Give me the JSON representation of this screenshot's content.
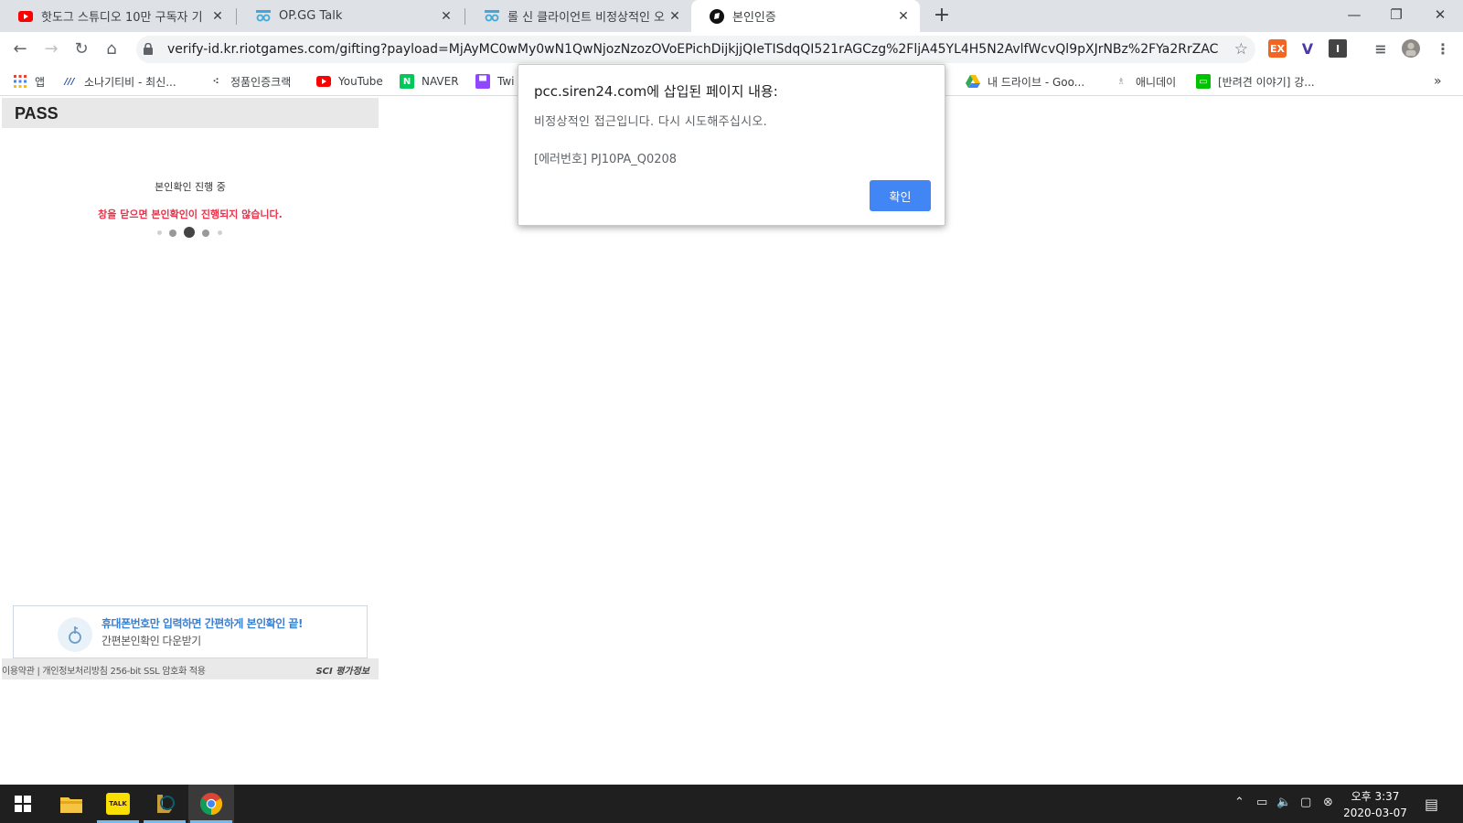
{
  "browser": {
    "tabs": [
      {
        "title": "핫도그 스튜디오 10만 구독자 기",
        "icon": "youtube-icon",
        "active": false
      },
      {
        "title": "OP.GG Talk",
        "icon": "opgg-icon",
        "active": false
      },
      {
        "title": "롤 신 클라이언트 비정상적인 오",
        "icon": "opgg-icon",
        "active": false
      },
      {
        "title": "본인인증",
        "icon": "riot-icon",
        "active": true
      }
    ],
    "url": "verify-id.kr.riotgames.com/gifting?payload=MjAyMC0wMy0wN1QwNjozNzozOVoEPichDijkjjQIeTISdqQI521rAGCzg%2FljA45YL4H5N2AvlfWcvQl9pXJrNBz%2FYa2RrZACduqP1...",
    "extensions": [
      {
        "icon": "ex-extension-icon",
        "label": "EX",
        "color": "#f26522"
      },
      {
        "icon": "v-extension-icon",
        "label": "V",
        "color": "#4b3aa6"
      },
      {
        "icon": "dark-extension-icon",
        "label": "I",
        "color": "#444444"
      }
    ],
    "bookmarks": [
      {
        "label": "앱",
        "icon": "apps-grid-icon"
      },
      {
        "label": "소나기티비 - 최신...",
        "icon": "sonagi-icon"
      },
      {
        "label": "정품인증크랙",
        "icon": "dots-icon"
      },
      {
        "label": "YouTube",
        "icon": "youtube-icon"
      },
      {
        "label": "NAVER",
        "icon": "naver-icon"
      },
      {
        "label": "Twi",
        "icon": "twitch-icon"
      },
      {
        "label": "내 드라이브 - Goo...",
        "icon": "google-drive-icon"
      },
      {
        "label": "애니데이",
        "icon": "aniday-icon"
      },
      {
        "label": "[반려견 이야기] 강...",
        "icon": "line-icon"
      }
    ],
    "bookmarks_more": "»"
  },
  "page": {
    "logo": "PASS",
    "progress_title": "본인확인 진행 중",
    "progress_warning": "창을 닫으면 본인확인이 진행되지 않습니다.",
    "promo_line1": "휴대폰번호만 입력하면 간편하게 본인확인 끝!",
    "promo_line2": "간편본인확인 다운받기",
    "footer_links": "이용약관 | 개인정보처리방침 256-bit SSL 암호화 적용",
    "footer_brand": "SCI 평가정보"
  },
  "dialog": {
    "title": "pcc.siren24.com에 삽입된 페이지 내용:",
    "message": "비정상적인 접근입니다. 다시 시도해주십시오.",
    "error_code": "[에러번호] PJ10PA_Q0208",
    "ok_label": "확인"
  },
  "taskbar": {
    "apps": [
      {
        "name": "start-button",
        "icon": "windows-icon"
      },
      {
        "name": "file-explorer",
        "icon": "folder-icon"
      },
      {
        "name": "kakaotalk",
        "icon": "kakaotalk-icon",
        "label": "TALK"
      },
      {
        "name": "league-of-legends",
        "icon": "lol-icon"
      },
      {
        "name": "chrome",
        "icon": "chrome-icon"
      }
    ],
    "time": "오후 3:37",
    "date": "2020-03-07"
  },
  "colors": {
    "accent": "#4285f4",
    "warning": "#e8334a",
    "promo_blue": "#3b7fd0"
  }
}
